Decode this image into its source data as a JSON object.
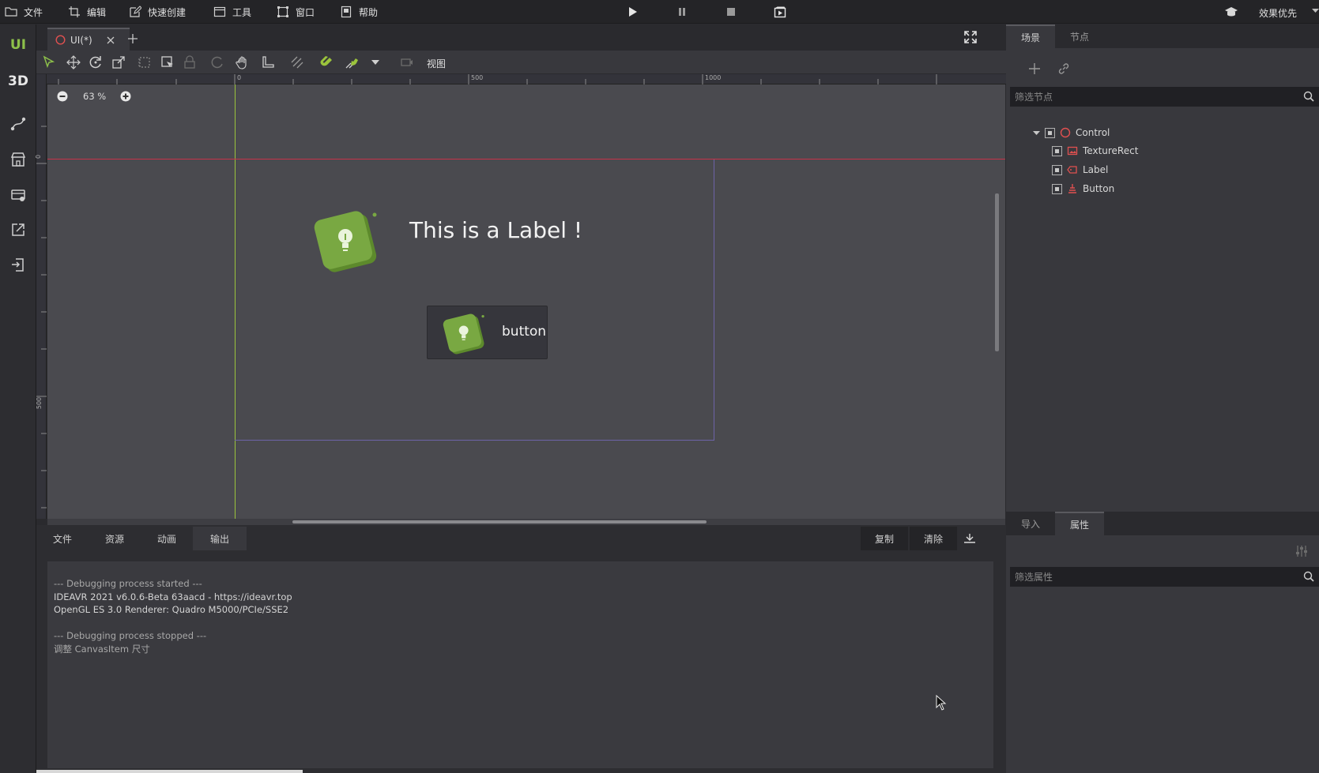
{
  "menubar": {
    "items": [
      "文件",
      "编辑",
      "快速创建",
      "工具",
      "窗口",
      "帮助"
    ],
    "quality_label": "效果优先"
  },
  "leftstrip": {
    "ui_label": "UI",
    "threed_label": "3D"
  },
  "doc_tab": {
    "label": "UI(*)"
  },
  "toolbar": {
    "view_label": "视图"
  },
  "ruler": {
    "h_labels": [
      "0",
      "500",
      "1000"
    ],
    "v_labels": [
      "0",
      "500"
    ]
  },
  "viewport": {
    "zoom": "63 %",
    "label_text": "This is a Label !",
    "button_text": "button"
  },
  "bottom": {
    "tabs": [
      "文件",
      "资源",
      "动画",
      "输出"
    ],
    "copy_label": "复制",
    "clear_label": "清除",
    "console_lines": [
      "--- Debugging process started ---",
      "IDEAVR 2021 v6.0.6-Beta 63aacd - https://ideavr.top",
      "OpenGL ES 3.0 Renderer: Quadro M5000/PCIe/SSE2",
      "",
      "--- Debugging process stopped ---",
      "调整 CanvasItem 尺寸"
    ]
  },
  "scene_panel": {
    "tabs": [
      "场景",
      "节点"
    ],
    "filter_placeholder": "筛选节点",
    "nodes": [
      {
        "name": "Control",
        "icon": "control-icon"
      },
      {
        "name": "TextureRect",
        "icon": "texture-rect-icon"
      },
      {
        "name": "Label",
        "icon": "label-node-icon"
      },
      {
        "name": "Button",
        "icon": "button-node-icon"
      }
    ]
  },
  "inspector_panel": {
    "tabs": [
      "导入",
      "属性"
    ],
    "filter_placeholder": "筛选属性"
  },
  "colors": {
    "accent_green": "#8dc04a",
    "guide_red": "#c8324a",
    "guide_green": "#9bc43c",
    "node_red": "#e05050"
  }
}
